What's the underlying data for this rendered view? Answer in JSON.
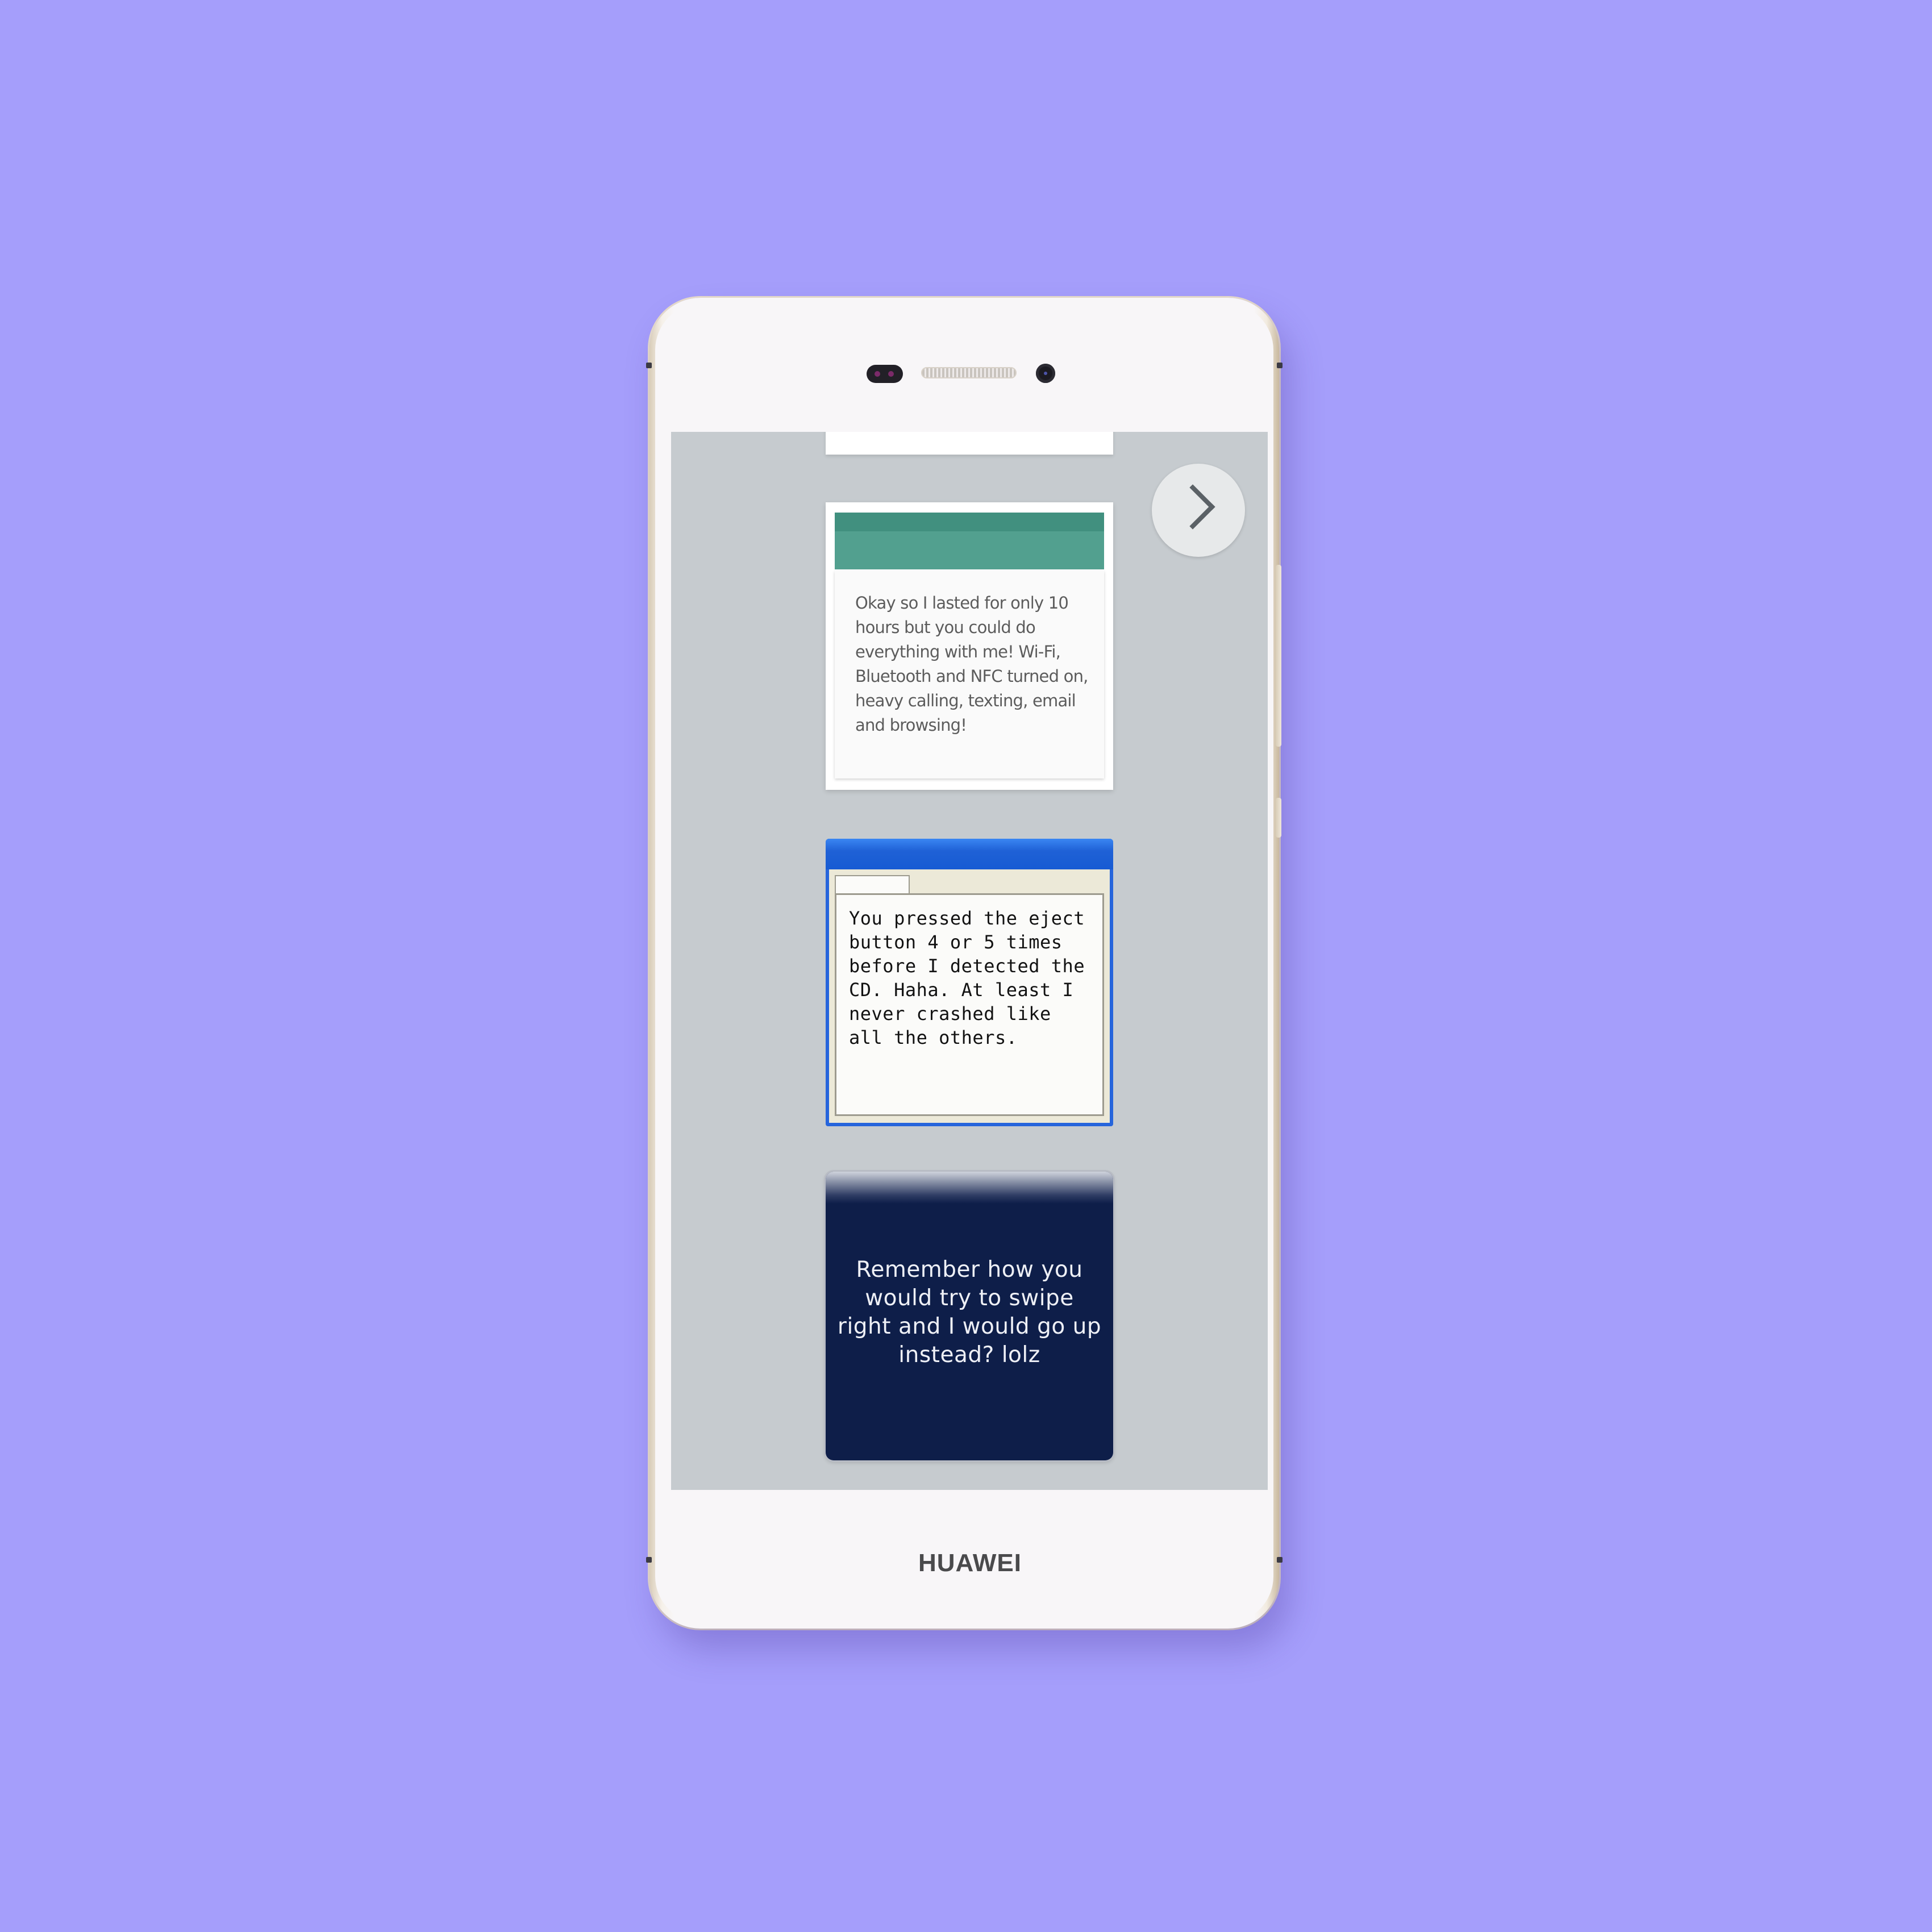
{
  "device": {
    "brand": "HUAWEI"
  },
  "screen": {
    "navigation": {
      "next_icon": "chevron-right-icon"
    },
    "cards": [
      {
        "style": "android-material",
        "header_color": "#52a08f",
        "text": "Okay so I lasted for only 10 hours but you could do everything with me! Wi-Fi, Bluetooth and NFC turned on, heavy calling, texting, email and browsing!"
      },
      {
        "style": "windows-xp",
        "titlebar_color": "#2665dc",
        "text": "You pressed the eject button 4 or 5 times before I detected the CD. Haha. At least I never crashed like all the others."
      },
      {
        "style": "ios-dark",
        "background_color": "#0e1e49",
        "text": "Remember how you would try to swipe right and I would go up instead? lolz"
      }
    ]
  },
  "colors": {
    "background": "#a59efb",
    "screen_background": "#c6cbcf"
  }
}
